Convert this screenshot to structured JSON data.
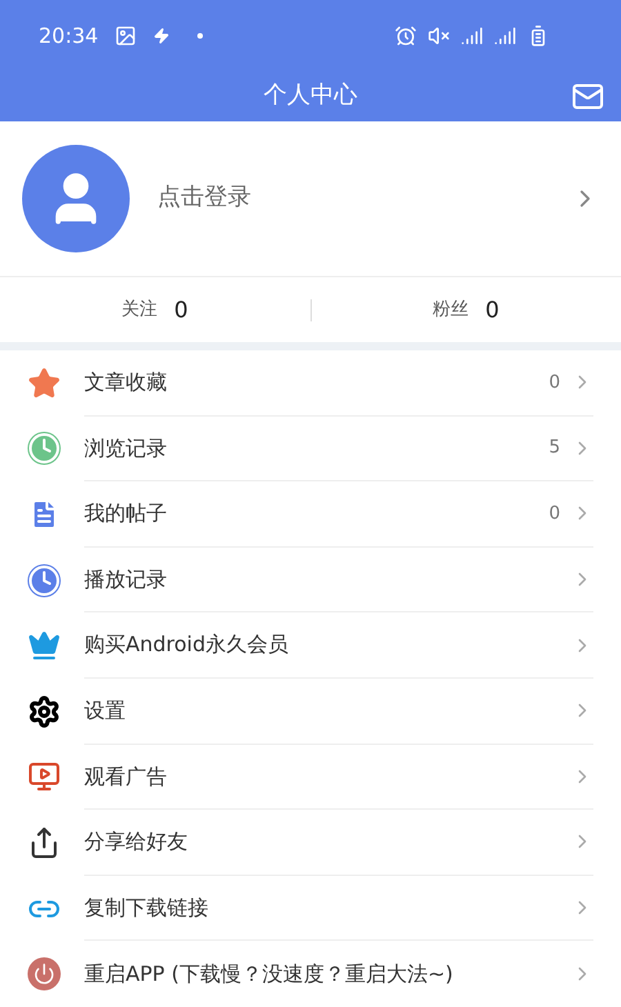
{
  "status_bar": {
    "time": "20:34"
  },
  "header": {
    "title": "个人中心"
  },
  "profile": {
    "login": "点击登录"
  },
  "stats": [
    {
      "label": "关注",
      "count": "0"
    },
    {
      "label": "粉丝",
      "count": "0"
    }
  ],
  "menu": [
    {
      "kind": "star",
      "label": "文章收藏",
      "count": "0"
    },
    {
      "kind": "history",
      "label": "浏览记录",
      "count": "5"
    },
    {
      "kind": "post",
      "label": "我的帖子",
      "count": "0"
    },
    {
      "kind": "play",
      "label": "播放记录"
    },
    {
      "kind": "vip",
      "label": "购买Android永久会员"
    },
    {
      "kind": "settings",
      "label": "设置"
    },
    {
      "kind": "ad",
      "label": "观看广告"
    },
    {
      "kind": "share",
      "label": "分享给好友"
    },
    {
      "kind": "link",
      "label": "复制下载链接"
    },
    {
      "kind": "restart",
      "label": "重启APP (下载慢？没速度？重启大法~)"
    }
  ]
}
